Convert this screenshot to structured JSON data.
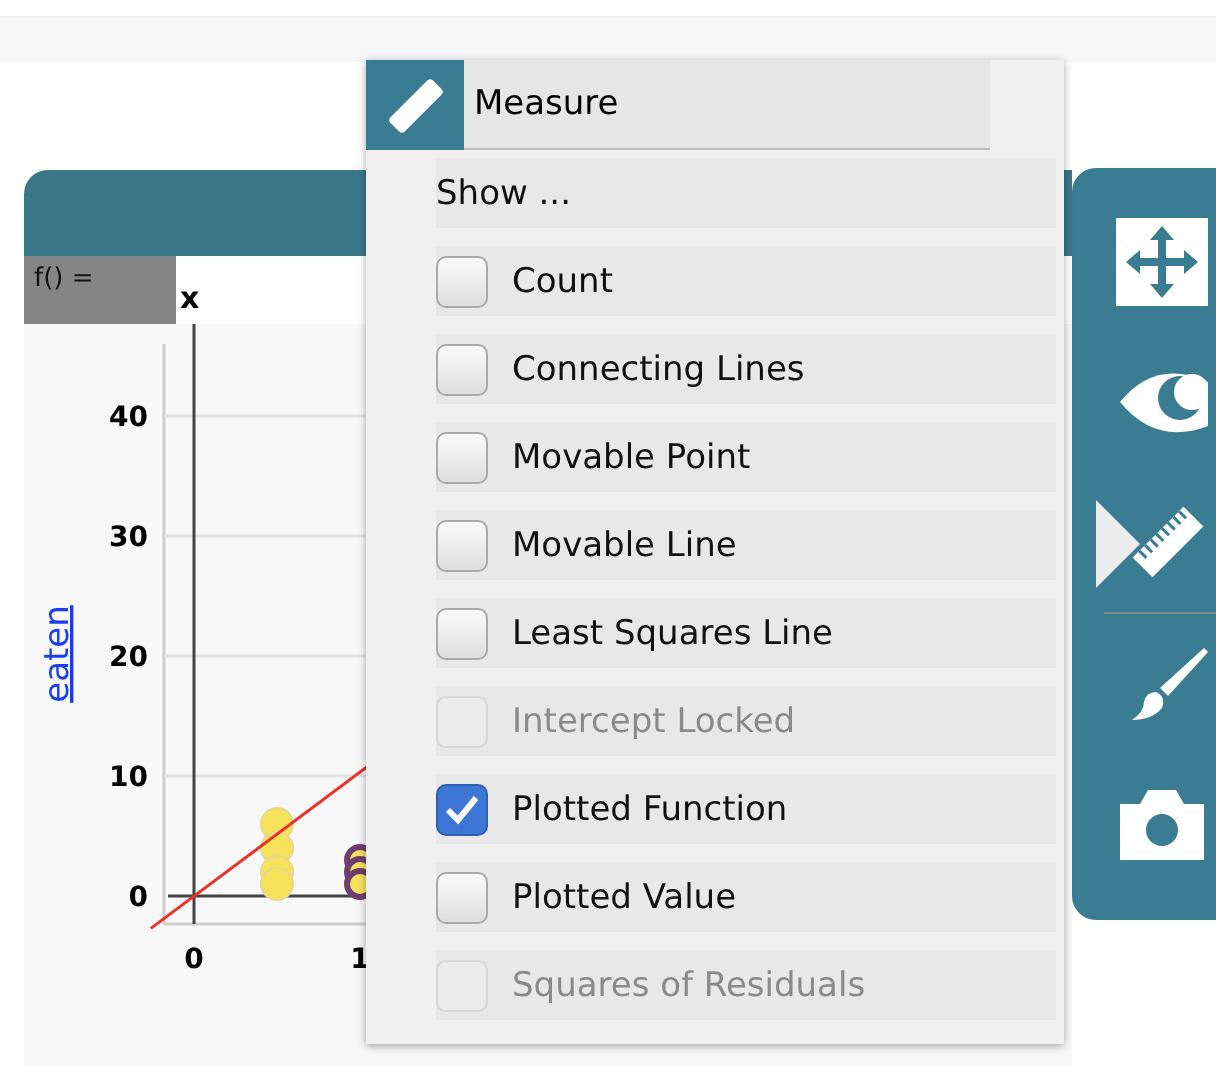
{
  "graph": {
    "formula_label": "f() =",
    "formula_value": "x",
    "y_axis_label": "eaten",
    "y_tick_labels": [
      "40",
      "30",
      "20",
      "10",
      "0"
    ],
    "x_tick_labels": [
      "0",
      "1"
    ]
  },
  "menu": {
    "title": "Measure",
    "heading": "Show ...",
    "items": [
      {
        "label": "Count",
        "checked": false,
        "disabled": false
      },
      {
        "label": "Connecting Lines",
        "checked": false,
        "disabled": false
      },
      {
        "label": "Movable Point",
        "checked": false,
        "disabled": false
      },
      {
        "label": "Movable Line",
        "checked": false,
        "disabled": false
      },
      {
        "label": "Least Squares Line",
        "checked": false,
        "disabled": false
      },
      {
        "label": "Intercept Locked",
        "checked": false,
        "disabled": true
      },
      {
        "label": "Plotted Function",
        "checked": true,
        "disabled": false
      },
      {
        "label": "Plotted Value",
        "checked": false,
        "disabled": false
      },
      {
        "label": "Squares of Residuals",
        "checked": false,
        "disabled": true
      }
    ]
  },
  "toolbar": [
    {
      "kind": "move",
      "selected": false
    },
    {
      "kind": "eye",
      "selected": false
    },
    {
      "kind": "ruler",
      "selected": true
    },
    {
      "kind": "brush",
      "selected": false
    },
    {
      "kind": "camera",
      "selected": false
    }
  ]
}
